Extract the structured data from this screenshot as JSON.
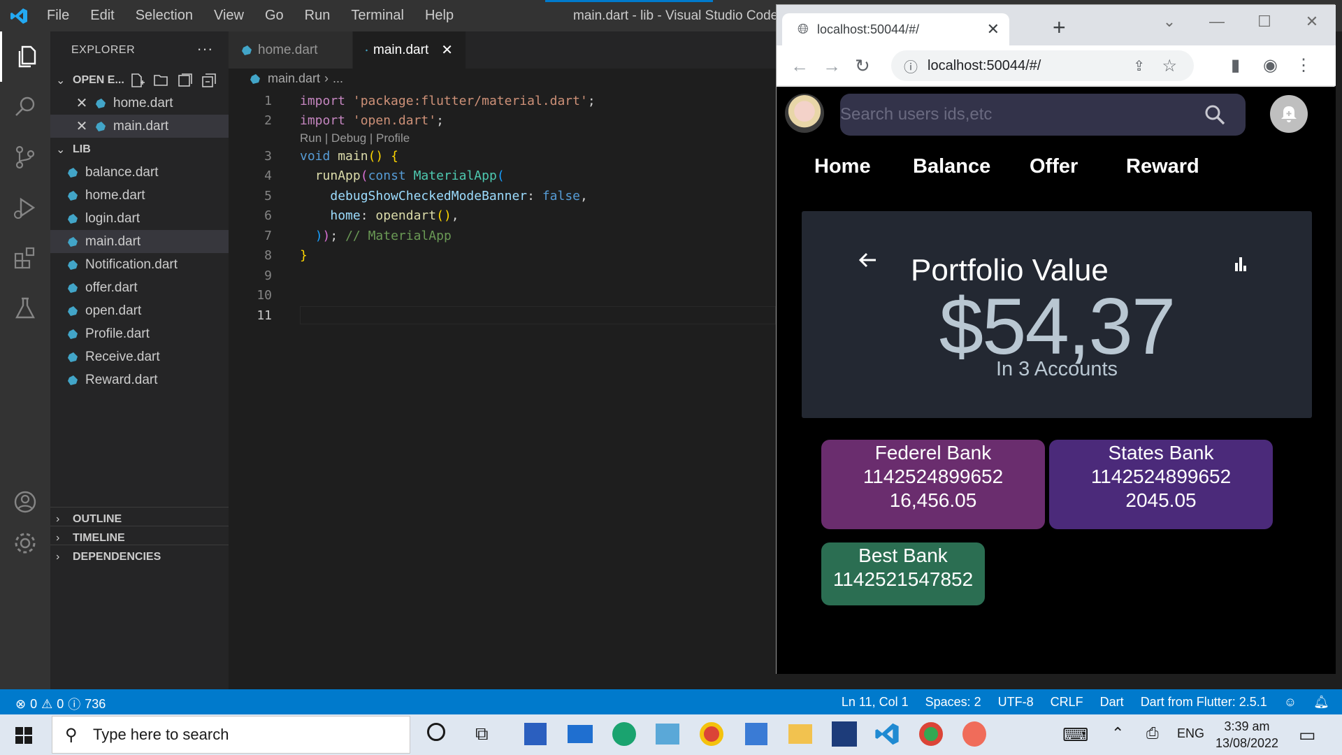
{
  "vscode": {
    "menu": [
      "File",
      "Edit",
      "Selection",
      "View",
      "Go",
      "Run",
      "Terminal",
      "Help"
    ],
    "window_title": "main.dart - lib - Visual Studio Code",
    "explorer_title": "EXPLORER",
    "open_editors_label": "OPEN E...",
    "open_editors": [
      "home.dart",
      "main.dart"
    ],
    "lib_label": "LIB",
    "lib_files": [
      "balance.dart",
      "home.dart",
      "login.dart",
      "main.dart",
      "Notification.dart",
      "offer.dart",
      "open.dart",
      "Profile.dart",
      "Receive.dart",
      "Reward.dart"
    ],
    "selected_file": "main.dart",
    "outline_label": "OUTLINE",
    "timeline_label": "TIMELINE",
    "dependencies_label": "DEPENDENCIES",
    "tabs": [
      {
        "label": "home.dart",
        "active": false
      },
      {
        "label": "main.dart",
        "active": true
      }
    ],
    "breadcrumb": {
      "file": "main.dart",
      "rest": "..."
    },
    "code_lens": "Run | Debug | Profile",
    "code_lines": {
      "l1_kw": "import",
      "l1_str": "'package:flutter/material.dart'",
      "l2_kw": "import",
      "l2_str": "'open.dart'",
      "l3_kw": "void",
      "l3_fn": "main",
      "l4_fn": "runApp",
      "l4_kw": "const",
      "l4_type": "MaterialApp",
      "l5_param": "debugShowCheckedModeBanner",
      "l5_val": "false",
      "l6_param": "home",
      "l6_fn": "opendart",
      "l7_comment": "// MaterialApp"
    },
    "line_numbers": [
      "1",
      "2",
      "3",
      "4",
      "5",
      "6",
      "7",
      "8",
      "9",
      "10",
      "11"
    ],
    "status": {
      "errors": "0",
      "warnings": "0",
      "info": "736",
      "position": "Ln 11, Col 1",
      "spaces": "Spaces: 2",
      "encoding": "UTF-8",
      "eol": "CRLF",
      "language": "Dart",
      "sdk": "Dart from Flutter: 2.5.1"
    }
  },
  "browser": {
    "tab_title": "localhost:50044/#/",
    "url": "localhost:50044/#/",
    "app": {
      "search_placeholder": "Search users ids,etc",
      "nav": [
        "Home",
        "Balance",
        "Offer",
        "Reward"
      ],
      "card_title": "Portfolio Value",
      "card_value": "$54,37",
      "card_sub": "In 3 Accounts",
      "banks": [
        {
          "name": "Federel Bank",
          "number": "1142524899652",
          "amount": "16,456.05",
          "color": "#6a2d6e"
        },
        {
          "name": "States Bank",
          "number": "1142524899652",
          "amount": "2045.05",
          "color": "#4b2a7a"
        },
        {
          "name": "Best Bank",
          "number": "1142521547852",
          "amount": "",
          "color": "#2b6e52"
        }
      ]
    }
  },
  "taskbar": {
    "search_placeholder": "Type here to search",
    "language": "ENG",
    "time": "3:39 am",
    "date": "13/08/2022"
  },
  "colors": {
    "accent": "#007acc",
    "editor_bg": "#1e1e1e",
    "app_bg": "#000000"
  }
}
